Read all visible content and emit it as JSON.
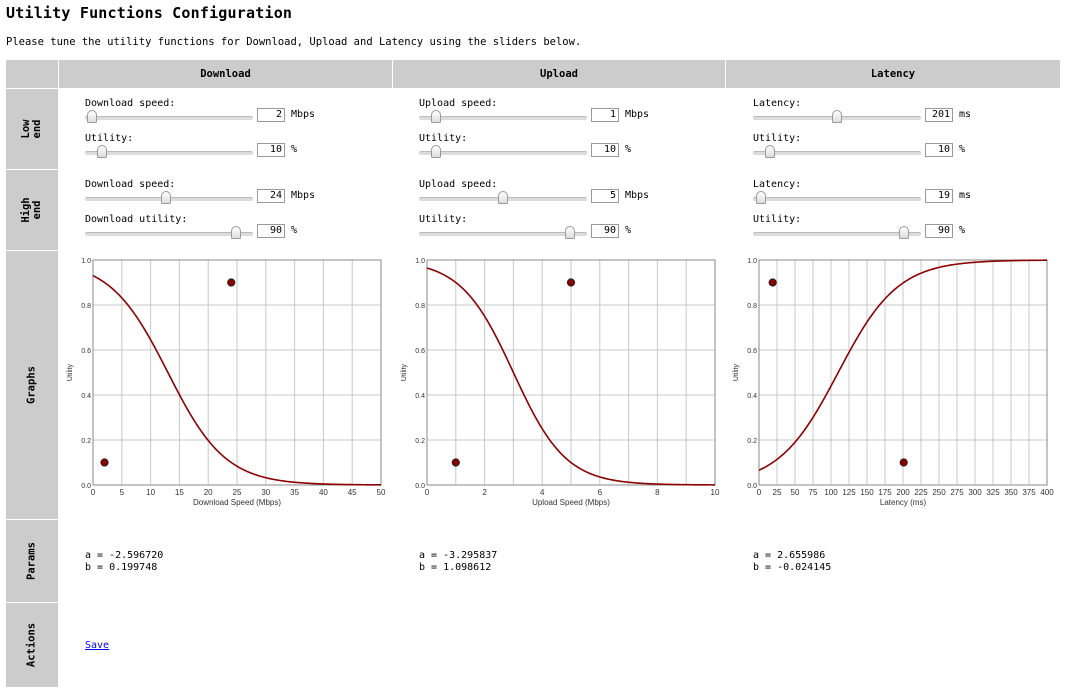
{
  "page": {
    "title": "Utility Functions Configuration",
    "intro": "Please tune the utility functions for Download, Upload and Latency using the sliders below."
  },
  "columns": [
    "Download",
    "Upload",
    "Latency"
  ],
  "rows": [
    "Low end",
    "High end",
    "Graphs",
    "Params",
    "Actions"
  ],
  "panels": [
    {
      "low": {
        "x": {
          "label": "Download speed:",
          "value": "2",
          "unit": "Mbps",
          "fraction": 0.04
        },
        "u": {
          "label": "Utility:",
          "value": "10",
          "unit": "%",
          "fraction": 0.1
        }
      },
      "high": {
        "x": {
          "label": "Download speed:",
          "value": "24",
          "unit": "Mbps",
          "fraction": 0.48
        },
        "u": {
          "label": "Download utility:",
          "value": "90",
          "unit": "%",
          "fraction": 0.9
        }
      },
      "params": {
        "a": "a = -2.596720",
        "b": "b = 0.199748"
      }
    },
    {
      "low": {
        "x": {
          "label": "Upload speed:",
          "value": "1",
          "unit": "Mbps",
          "fraction": 0.1
        },
        "u": {
          "label": "Utility:",
          "value": "10",
          "unit": "%",
          "fraction": 0.1
        }
      },
      "high": {
        "x": {
          "label": "Upload speed:",
          "value": "5",
          "unit": "Mbps",
          "fraction": 0.5
        },
        "u": {
          "label": "Utility:",
          "value": "90",
          "unit": "%",
          "fraction": 0.9
        }
      },
      "params": {
        "a": "a = -3.295837",
        "b": "b = 1.098612"
      }
    },
    {
      "low": {
        "x": {
          "label": "Latency:",
          "value": "201",
          "unit": "ms",
          "fraction": 0.5
        },
        "u": {
          "label": "Utility:",
          "value": "10",
          "unit": "%",
          "fraction": 0.1
        }
      },
      "high": {
        "x": {
          "label": "Latency:",
          "value": "19",
          "unit": "ms",
          "fraction": 0.05
        },
        "u": {
          "label": "Utility:",
          "value": "90",
          "unit": "%",
          "fraction": 0.9
        }
      },
      "params": {
        "a": "a = 2.655986",
        "b": "b = -0.024145"
      }
    }
  ],
  "actions": {
    "save_label": "Save"
  },
  "chart_data": [
    {
      "type": "line",
      "xlabel": "Download Speed (Mbps)",
      "ylabel": "Utility",
      "xlim": [
        0,
        50
      ],
      "ylim": [
        0,
        1
      ],
      "xticks": [
        0,
        5,
        10,
        15,
        20,
        25,
        30,
        35,
        40,
        45,
        50
      ],
      "yticks": [
        0.0,
        0.2,
        0.4,
        0.6,
        0.8,
        1.0
      ],
      "ytick_labels": [
        "0.0",
        "0.2",
        "0.4",
        "0.6",
        "0.8",
        "1.0"
      ],
      "grid": true,
      "curve": {
        "function": "logistic",
        "a": -2.59672,
        "b": 0.199748,
        "color": "#8b0000"
      },
      "points": [
        {
          "x": 2,
          "y": 0.1
        },
        {
          "x": 24,
          "y": 0.9
        }
      ]
    },
    {
      "type": "line",
      "xlabel": "Upload Speed (Mbps)",
      "ylabel": "Utility",
      "xlim": [
        0,
        10
      ],
      "ylim": [
        0,
        1
      ],
      "xticks": [
        0,
        2,
        4,
        6,
        8,
        10
      ],
      "minor_xticks": [
        1,
        3,
        5,
        7,
        9
      ],
      "yticks": [
        0.0,
        0.2,
        0.4,
        0.6,
        0.8,
        1.0
      ],
      "ytick_labels": [
        "0.0",
        "0.2",
        "0.4",
        "0.6",
        "0.8",
        "1.0"
      ],
      "grid": true,
      "curve": {
        "function": "logistic",
        "a": -3.295837,
        "b": 1.098612,
        "color": "#8b0000"
      },
      "points": [
        {
          "x": 1,
          "y": 0.1
        },
        {
          "x": 5,
          "y": 0.9
        }
      ]
    },
    {
      "type": "line",
      "xlabel": "Latency (ms)",
      "ylabel": "Utility",
      "xlim": [
        0,
        400
      ],
      "ylim": [
        0,
        1
      ],
      "xticks": [
        0,
        25,
        50,
        75,
        100,
        125,
        150,
        175,
        200,
        225,
        250,
        275,
        300,
        325,
        350,
        375,
        400
      ],
      "yticks": [
        0.0,
        0.2,
        0.4,
        0.6,
        0.8,
        1.0
      ],
      "ytick_labels": [
        "0.0",
        "0.2",
        "0.4",
        "0.6",
        "0.8",
        "1.0"
      ],
      "grid": true,
      "curve": {
        "function": "logistic",
        "a": 2.655986,
        "b": -0.024145,
        "color": "#8b0000"
      },
      "points": [
        {
          "x": 19,
          "y": 0.9
        },
        {
          "x": 201,
          "y": 0.1
        }
      ]
    }
  ]
}
